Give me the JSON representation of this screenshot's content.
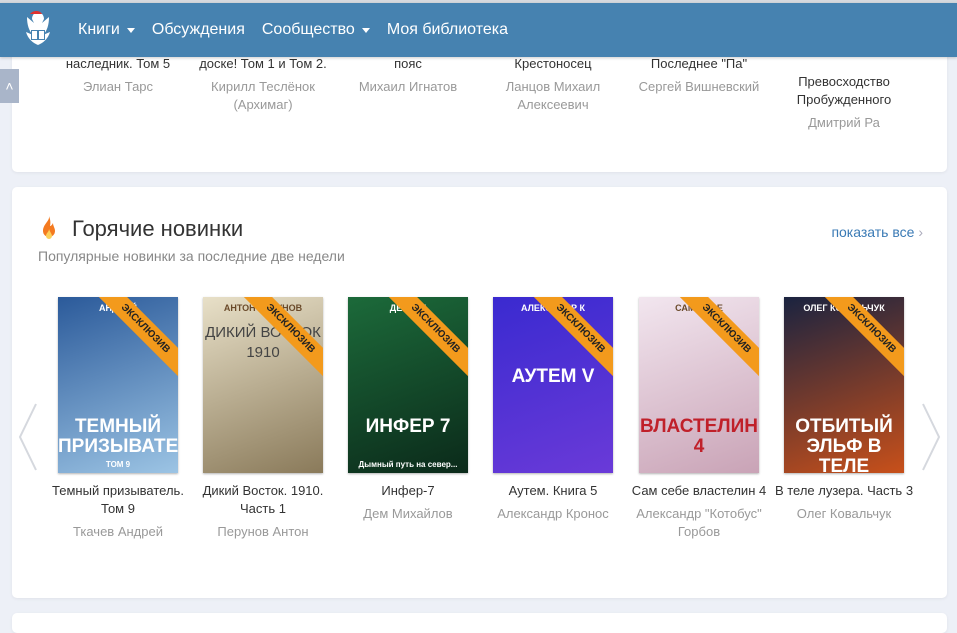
{
  "nav": {
    "items": [
      {
        "label": "Книги",
        "dropdown": true
      },
      {
        "label": "Обсуждения",
        "dropdown": false
      },
      {
        "label": "Сообщество",
        "dropdown": true
      },
      {
        "label": "Моя библиотека",
        "dropdown": false
      }
    ]
  },
  "prev_books": [
    {
      "title": "наследник. Том 5",
      "author": "Элиан Тарс"
    },
    {
      "title": "доске! Том 1 и Том 2.",
      "author": "Кирилл Теслёнок (Архимаг)"
    },
    {
      "title": "пояс",
      "author": "Михаил Игнатов"
    },
    {
      "title": "Крестоносец",
      "author": "Ланцов Михаил Алексеевич"
    },
    {
      "title": "Последнее \"Па\"",
      "author": "Сергей Вишневский"
    },
    {
      "title": "Превосходство Пробужденного",
      "author": "Дмитрий Ра"
    }
  ],
  "hot": {
    "title": "Горячие новинки",
    "subtitle": "Популярные новинки за последние две недели",
    "show_all": "показать все",
    "badge": "ЭКСКЛЮЗИВ",
    "books": [
      {
        "title": "Темный призыватель. Том 9",
        "author": "Ткачев Андрей",
        "cover_top": "АНДРЕЙ",
        "cover_big": "ТЕМНЫЙ ПРИЗЫВАТЕЛЬ",
        "cover_note": "ТОМ 9",
        "color1": "#2b5a9a",
        "color2": "#9cc4e4"
      },
      {
        "title": "Дикий Восток. 1910. Часть 1",
        "author": "Перунов Антон",
        "cover_top": "АНТОН ПЕРУНОВ",
        "cover_big": "ДИКИЙ ВОСТОК 1910",
        "cover_note": "",
        "color1": "#e8e0c8",
        "color2": "#8a7a5a"
      },
      {
        "title": "Инфер-7",
        "author": "Дем Михайлов",
        "cover_top": "ДЕМ МИ",
        "cover_big": "ИНФЕР 7",
        "cover_note": "Дымный путь на север...",
        "color1": "#1c6a3a",
        "color2": "#0b2a1a"
      },
      {
        "title": "Аутем. Книга 5",
        "author": "Александр Кронос",
        "cover_top": "АЛЕКСАНДР К",
        "cover_big": "АУТЕМ V",
        "cover_note": "",
        "color1": "#3a2ad0",
        "color2": "#6a3ad8"
      },
      {
        "title": "Сам себе властелин 4",
        "author": "Александр \"Котобус\" Горбов",
        "cover_top": "САМ СЕБЕ",
        "cover_big": "ВЛАСТЕЛИН 4",
        "cover_note": "",
        "color1": "#f2e6ef",
        "color2": "#c9a3b6"
      },
      {
        "title": "В теле лузера. Часть 3",
        "author": "Олег Ковальчук",
        "cover_top": "ОЛЕГ КОВАЛЬЧУК",
        "cover_big": "ОТБИТЫЙ ЭЛЬФ В ТЕЛЕ ЛУЗЕРА",
        "cover_note": "",
        "color1": "#1a2340",
        "color2": "#c8501a"
      }
    ]
  }
}
